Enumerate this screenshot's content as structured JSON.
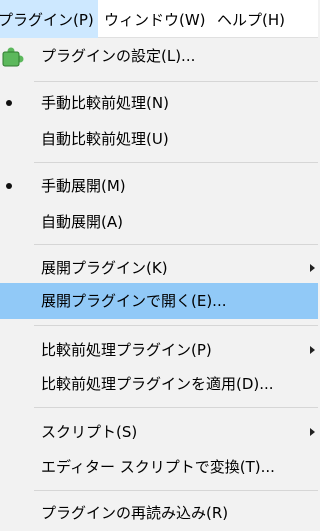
{
  "menubar": {
    "plugins": "プラグイン(P)",
    "window": "ウィンドウ(W)",
    "help": "ヘルプ(H)"
  },
  "menu": {
    "plugin_settings": "プラグインの設定(L)...",
    "manual_prediff": "手動比較前処理(N)",
    "auto_prediff": "自動比較前処理(U)",
    "manual_unpack": "手動展開(M)",
    "auto_unpack": "自動展開(A)",
    "unpack_plugin": "展開プラグイン(K)",
    "open_with_unpack_plugin": "展開プラグインで開く(E)...",
    "prediff_plugin": "比較前処理プラグイン(P)",
    "apply_prediff_plugin": "比較前処理プラグインを適用(D)...",
    "scripts": "スクリプト(S)",
    "editor_script_transform": "エディター スクリプトで変換(T)...",
    "reload_plugins": "プラグインの再読み込み(R)"
  },
  "colors": {
    "menubar_active": "#cde8ff",
    "highlight": "#91c9f7",
    "menu_background": "#f2f2f2",
    "plugin_icon": "#5cb85c"
  },
  "icons": {
    "plugin_settings": "puzzle-piece-icon"
  }
}
